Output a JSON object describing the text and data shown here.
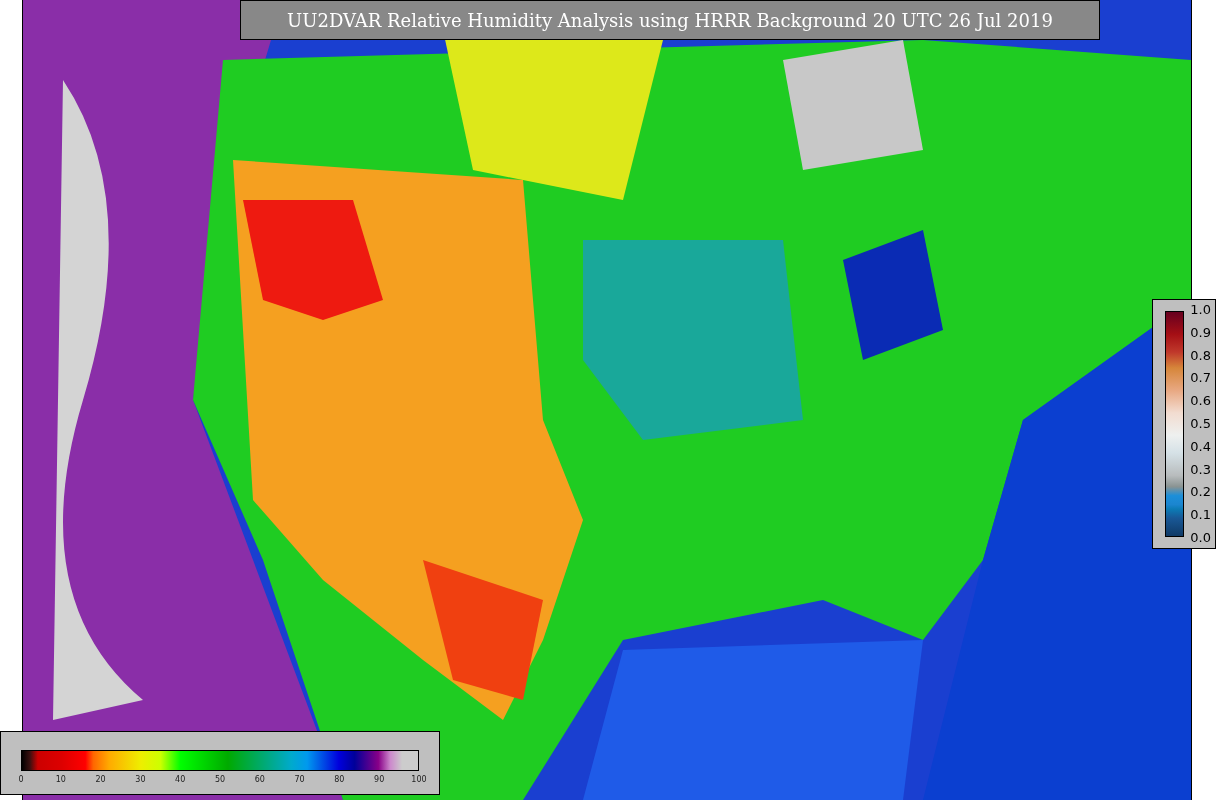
{
  "title": "UU2DVAR Relative Humidity Analysis using HRRR Background 20 UTC 26 Jul 2019",
  "station_legend": {
    "ticks": [
      "1.0",
      "0.9",
      "0.8",
      "0.7",
      "0.6",
      "0.5",
      "0.4",
      "0.3",
      "0.2",
      "0.1",
      "0.0"
    ]
  },
  "humidity_legend": {
    "ticks": [
      "0",
      "10",
      "20",
      "30",
      "40",
      "50",
      "60",
      "70",
      "80",
      "90",
      "100"
    ]
  }
}
